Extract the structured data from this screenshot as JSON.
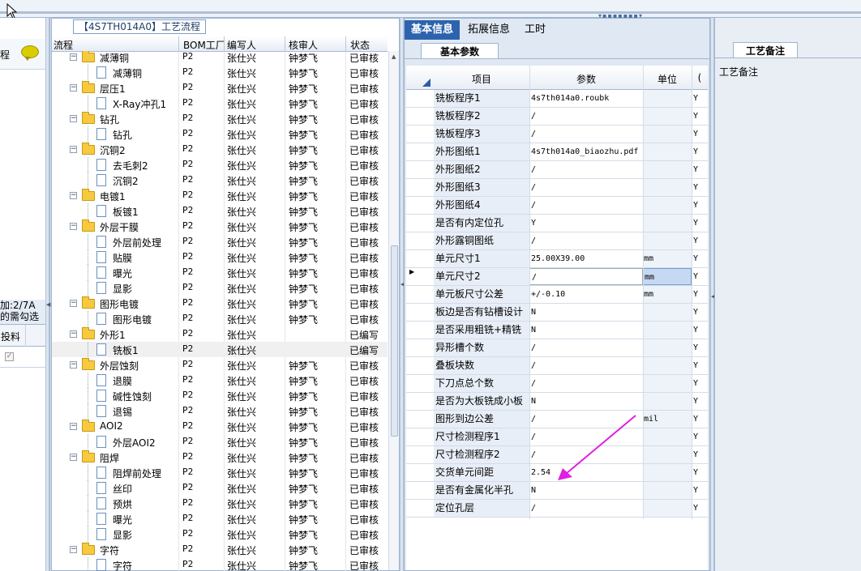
{
  "flow_title": "【4S7TH014A0】工艺流程",
  "tree_columns": [
    "流程",
    "BOM工厂",
    "编写人",
    "核审人",
    "状态"
  ],
  "tree_rows": [
    {
      "label": "减薄铜",
      "level": 0,
      "type": "folder",
      "bom": "P2",
      "writer": "张仕兴",
      "reviewer": "钟梦飞",
      "status": "已审核"
    },
    {
      "label": "减薄铜",
      "level": 1,
      "type": "doc",
      "bom": "P2",
      "writer": "张仕兴",
      "reviewer": "钟梦飞",
      "status": "已审核"
    },
    {
      "label": "层压1",
      "level": 0,
      "type": "folder",
      "bom": "P2",
      "writer": "张仕兴",
      "reviewer": "钟梦飞",
      "status": "已审核"
    },
    {
      "label": "X-Ray冲孔1",
      "level": 1,
      "type": "doc",
      "bom": "P2",
      "writer": "张仕兴",
      "reviewer": "钟梦飞",
      "status": "已审核"
    },
    {
      "label": "钻孔",
      "level": 0,
      "type": "folder",
      "bom": "P2",
      "writer": "张仕兴",
      "reviewer": "钟梦飞",
      "status": "已审核"
    },
    {
      "label": "钻孔",
      "level": 1,
      "type": "doc",
      "bom": "P2",
      "writer": "张仕兴",
      "reviewer": "钟梦飞",
      "status": "已审核"
    },
    {
      "label": "沉铜2",
      "level": 0,
      "type": "folder",
      "bom": "P2",
      "writer": "张仕兴",
      "reviewer": "钟梦飞",
      "status": "已审核"
    },
    {
      "label": "去毛刺2",
      "level": 1,
      "type": "doc",
      "bom": "P2",
      "writer": "张仕兴",
      "reviewer": "钟梦飞",
      "status": "已审核"
    },
    {
      "label": "沉铜2",
      "level": 1,
      "type": "doc",
      "bom": "P2",
      "writer": "张仕兴",
      "reviewer": "钟梦飞",
      "status": "已审核"
    },
    {
      "label": "电镀1",
      "level": 0,
      "type": "folder",
      "bom": "P2",
      "writer": "张仕兴",
      "reviewer": "钟梦飞",
      "status": "已审核"
    },
    {
      "label": "板镀1",
      "level": 1,
      "type": "doc",
      "bom": "P2",
      "writer": "张仕兴",
      "reviewer": "钟梦飞",
      "status": "已审核"
    },
    {
      "label": "外层干膜",
      "level": 0,
      "type": "folder",
      "bom": "P2",
      "writer": "张仕兴",
      "reviewer": "钟梦飞",
      "status": "已审核"
    },
    {
      "label": "外层前处理",
      "level": 1,
      "type": "doc",
      "bom": "P2",
      "writer": "张仕兴",
      "reviewer": "钟梦飞",
      "status": "已审核"
    },
    {
      "label": "贴膜",
      "level": 1,
      "type": "doc",
      "bom": "P2",
      "writer": "张仕兴",
      "reviewer": "钟梦飞",
      "status": "已审核"
    },
    {
      "label": "曝光",
      "level": 1,
      "type": "doc",
      "bom": "P2",
      "writer": "张仕兴",
      "reviewer": "钟梦飞",
      "status": "已审核"
    },
    {
      "label": "显影",
      "level": 1,
      "type": "doc",
      "bom": "P2",
      "writer": "张仕兴",
      "reviewer": "钟梦飞",
      "status": "已审核"
    },
    {
      "label": "图形电镀",
      "level": 0,
      "type": "folder",
      "bom": "P2",
      "writer": "张仕兴",
      "reviewer": "钟梦飞",
      "status": "已审核"
    },
    {
      "label": "图形电镀",
      "level": 1,
      "type": "doc",
      "bom": "P2",
      "writer": "张仕兴",
      "reviewer": "钟梦飞",
      "status": "已审核"
    },
    {
      "label": "外形1",
      "level": 0,
      "type": "folder",
      "bom": "P2",
      "writer": "张仕兴",
      "reviewer": "",
      "status": "已编写"
    },
    {
      "label": "铣板1",
      "level": 1,
      "type": "doc",
      "bom": "P2",
      "writer": "张仕兴",
      "reviewer": "",
      "status": "已编写",
      "selected": true
    },
    {
      "label": "外层蚀刻",
      "level": 0,
      "type": "folder",
      "bom": "P2",
      "writer": "张仕兴",
      "reviewer": "钟梦飞",
      "status": "已审核"
    },
    {
      "label": "退膜",
      "level": 1,
      "type": "doc",
      "bom": "P2",
      "writer": "张仕兴",
      "reviewer": "钟梦飞",
      "status": "已审核"
    },
    {
      "label": "碱性蚀刻",
      "level": 1,
      "type": "doc",
      "bom": "P2",
      "writer": "张仕兴",
      "reviewer": "钟梦飞",
      "status": "已审核"
    },
    {
      "label": "退锡",
      "level": 1,
      "type": "doc",
      "bom": "P2",
      "writer": "张仕兴",
      "reviewer": "钟梦飞",
      "status": "已审核"
    },
    {
      "label": "AOI2",
      "level": 0,
      "type": "folder",
      "bom": "P2",
      "writer": "张仕兴",
      "reviewer": "钟梦飞",
      "status": "已审核"
    },
    {
      "label": "外层AOI2",
      "level": 1,
      "type": "doc",
      "bom": "P2",
      "writer": "张仕兴",
      "reviewer": "钟梦飞",
      "status": "已审核"
    },
    {
      "label": "阻焊",
      "level": 0,
      "type": "folder",
      "bom": "P2",
      "writer": "张仕兴",
      "reviewer": "钟梦飞",
      "status": "已审核"
    },
    {
      "label": "阻焊前处理",
      "level": 1,
      "type": "doc",
      "bom": "P2",
      "writer": "张仕兴",
      "reviewer": "钟梦飞",
      "status": "已审核"
    },
    {
      "label": "丝印",
      "level": 1,
      "type": "doc",
      "bom": "P2",
      "writer": "张仕兴",
      "reviewer": "钟梦飞",
      "status": "已审核"
    },
    {
      "label": "预烘",
      "level": 1,
      "type": "doc",
      "bom": "P2",
      "writer": "张仕兴",
      "reviewer": "钟梦飞",
      "status": "已审核"
    },
    {
      "label": "曝光",
      "level": 1,
      "type": "doc",
      "bom": "P2",
      "writer": "张仕兴",
      "reviewer": "钟梦飞",
      "status": "已审核"
    },
    {
      "label": "显影",
      "level": 1,
      "type": "doc",
      "bom": "P2",
      "writer": "张仕兴",
      "reviewer": "钟梦飞",
      "status": "已审核"
    },
    {
      "label": "字符",
      "level": 0,
      "type": "folder",
      "bom": "P2",
      "writer": "张仕兴",
      "reviewer": "钟梦飞",
      "status": "已审核"
    },
    {
      "label": "字符",
      "level": 1,
      "type": "doc",
      "bom": "P2",
      "writer": "张仕兴",
      "reviewer": "钟梦飞",
      "status": "已审核"
    }
  ],
  "left_panel": {
    "header_text": "程",
    "counter_text": "加:2/7A",
    "hint_text": "的需勾选",
    "column_label": "投料"
  },
  "tabs": [
    "基本信息",
    "拓展信息",
    "工时"
  ],
  "active_tab": 0,
  "subtab": "基本参数",
  "grid_columns": [
    "项目",
    "参数",
    "单位",
    "("
  ],
  "grid_rows": [
    {
      "item": "铣板程序1",
      "param": "4s7th014a0.roubk",
      "unit": "",
      "flag": "Y"
    },
    {
      "item": "铣板程序2",
      "param": "/",
      "unit": "",
      "flag": "Y"
    },
    {
      "item": "铣板程序3",
      "param": "/",
      "unit": "",
      "flag": "Y"
    },
    {
      "item": "外形图纸1",
      "param": "4s7th014a0_biaozhu.pdf",
      "unit": "",
      "flag": "Y"
    },
    {
      "item": "外形图纸2",
      "param": "/",
      "unit": "",
      "flag": "Y"
    },
    {
      "item": "外形图纸3",
      "param": "/",
      "unit": "",
      "flag": "Y"
    },
    {
      "item": "外形图纸4",
      "param": "/",
      "unit": "",
      "flag": "Y"
    },
    {
      "item": "是否有内定位孔",
      "param": "Y",
      "unit": "",
      "flag": "Y"
    },
    {
      "item": "外形露铜图纸",
      "param": "/",
      "unit": "",
      "flag": "Y"
    },
    {
      "item": "单元尺寸1",
      "param": "25.00X39.00",
      "unit": "mm",
      "flag": "Y"
    },
    {
      "item": "单元尺寸2",
      "param": "/",
      "unit": "mm",
      "flag": "Y",
      "current": true
    },
    {
      "item": "单元板尺寸公差",
      "param": "+/-0.10",
      "unit": "mm",
      "flag": "Y"
    },
    {
      "item": "板边是否有钻槽设计",
      "param": "N",
      "unit": "",
      "flag": "Y"
    },
    {
      "item": "是否采用粗铣+精铣",
      "param": "N",
      "unit": "",
      "flag": "Y"
    },
    {
      "item": "异形槽个数",
      "param": "/",
      "unit": "",
      "flag": "Y"
    },
    {
      "item": "叠板块数",
      "param": "/",
      "unit": "",
      "flag": "Y"
    },
    {
      "item": "下刀点总个数",
      "param": "/",
      "unit": "",
      "flag": "Y"
    },
    {
      "item": "是否为大板铣成小板",
      "param": "N",
      "unit": "",
      "flag": "Y"
    },
    {
      "item": "图形到边公差",
      "param": "/",
      "unit": "mil",
      "flag": "Y"
    },
    {
      "item": "尺寸检测程序1",
      "param": "/",
      "unit": "",
      "flag": "Y"
    },
    {
      "item": "尺寸检测程序2",
      "param": "/",
      "unit": "",
      "flag": "Y"
    },
    {
      "item": "交货单元间距",
      "param": "2.54",
      "unit": "",
      "flag": "Y"
    },
    {
      "item": "是否有金属化半孔",
      "param": "N",
      "unit": "",
      "flag": "Y"
    },
    {
      "item": "定位孔层",
      "param": "/",
      "unit": "",
      "flag": "Y"
    }
  ],
  "notes_tab": "工艺备注",
  "notes_label": "工艺备注",
  "colors": {
    "accent": "#2d63ad",
    "arrow": "#e020e0"
  },
  "icons": [
    "cursor-icon",
    "comment-icon",
    "folder-icon",
    "document-icon",
    "collapse-icon",
    "row-pointer-icon",
    "checkbox-icon",
    "splitter-arrow-icon"
  ]
}
